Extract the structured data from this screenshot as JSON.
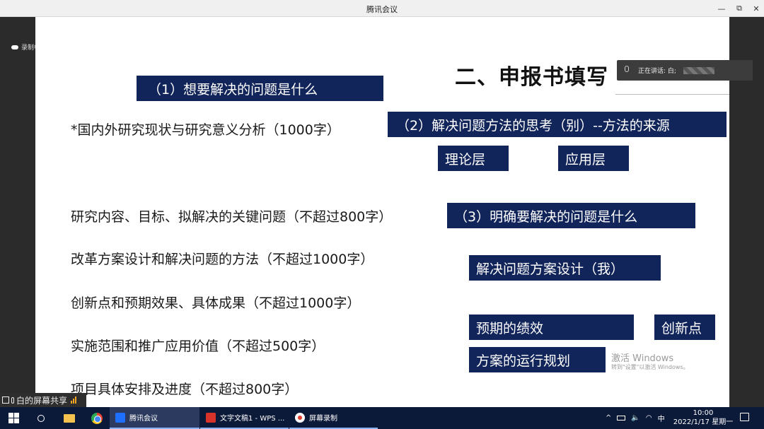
{
  "window": {
    "title": "腾讯会议",
    "min_glyph": "—",
    "max_glyph": "⧉",
    "close_glyph": "✕"
  },
  "recording": {
    "label": "录制中"
  },
  "speaking": {
    "label": "正在讲话: 白;"
  },
  "slide": {
    "title": "二、申报书填写",
    "left_items": [
      "*国内外研究现状与研究意义分析（1000字）",
      "研究内容、目标、拟解决的关键问题（不超过800字）",
      "改革方案设计和解决问题的方法（不超过1000字）",
      "创新点和预期效果、具体成果（不超过1000字）",
      "实施范围和推广应用价值（不超过500字）",
      "项目具体安排及进度（不超过800字）"
    ],
    "boxes": {
      "q1": "（1）想要解决的问题是什么",
      "q2": "（2）解决问题方法的思考（别）--方法的来源",
      "theory": "理论层",
      "application": "应用层",
      "q3": "（3）明确要解决的问题是什么",
      "solution": "解决问题方案设计（我）",
      "performance": "预期的绩效",
      "innovation": "创新点",
      "plan": "方案的运行规划"
    },
    "watermark": {
      "line1": "激活 Windows",
      "line2": "转到\"设置\"以激活 Windows。"
    }
  },
  "share": {
    "label": "白的屏幕共享"
  },
  "taskbar": {
    "tasks": [
      {
        "label": "腾讯会议"
      },
      {
        "label": "文字文稿1 - WPS ..."
      },
      {
        "label": "屏幕录制"
      }
    ],
    "tray": {
      "chevron": "^",
      "ime": "中"
    },
    "clock": {
      "time": "10:00",
      "date": "2022/1/17 星期一"
    }
  },
  "colors": {
    "box_bg": "#12255a",
    "taskbar_bg": "#0c1a3a"
  }
}
